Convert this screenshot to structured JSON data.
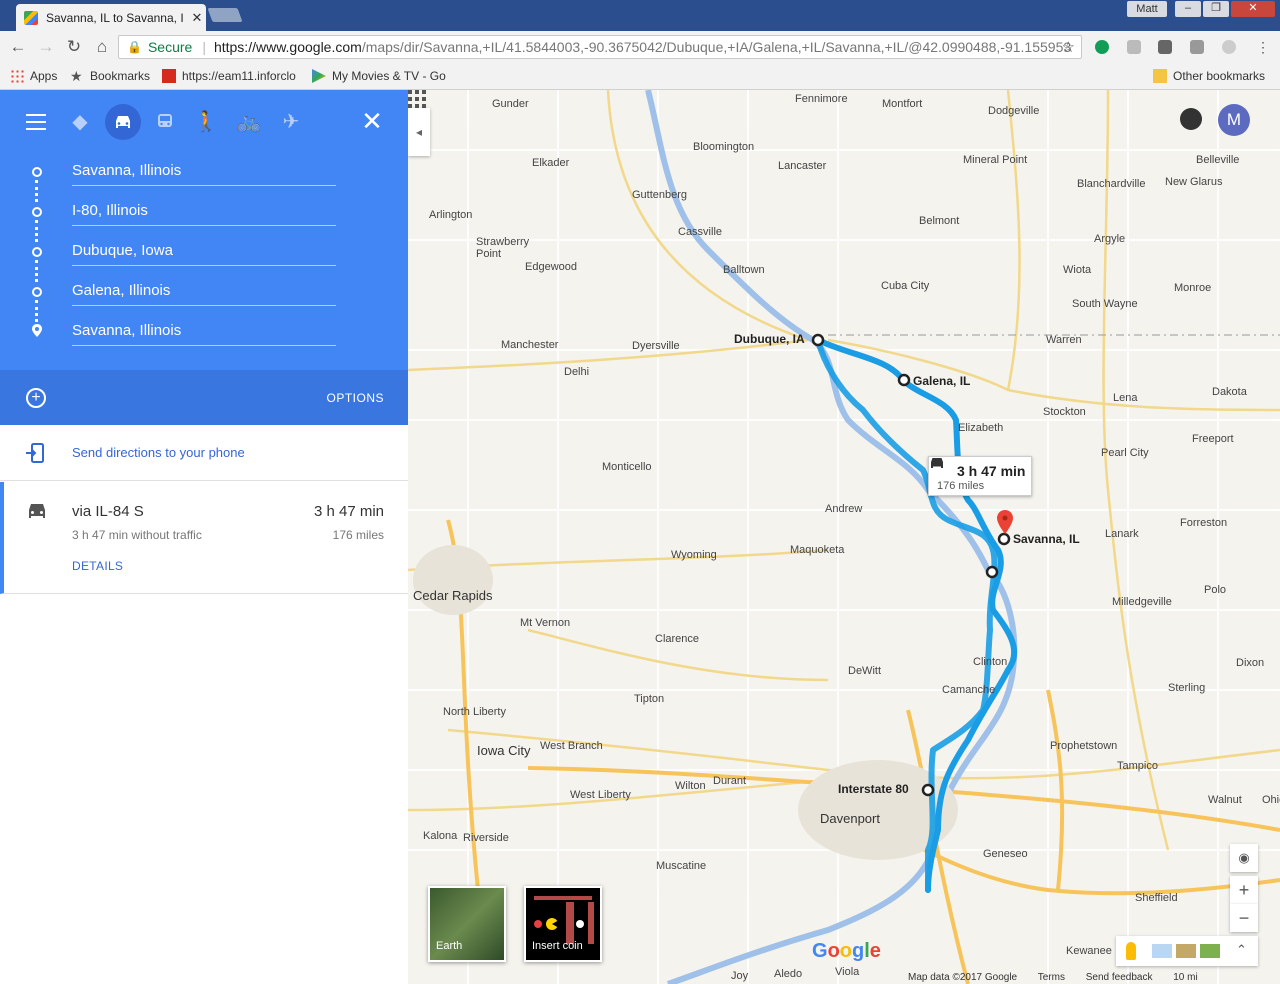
{
  "browser": {
    "tab_title": "Savanna, IL to Savanna, I",
    "user_badge": "Matt",
    "secure_label": "Secure",
    "url_host": "https://www.google.com",
    "url_rest": "/maps/dir/Savanna,+IL/41.5844003,-90.3675042/Dubuque,+IA/Galena,+IL/Savanna,+IL/@42.0990488,-91.155953",
    "bookmarks": [
      "Apps",
      "Bookmarks",
      "https://eam11.inforclo",
      "My Movies & TV - Go"
    ],
    "other_bookmarks": "Other bookmarks"
  },
  "panel": {
    "stops": [
      "Savanna, Illinois",
      "I-80, Illinois",
      "Dubuque, Iowa",
      "Galena, Illinois",
      "Savanna, Illinois"
    ],
    "options_label": "OPTIONS",
    "send_label": "Send directions to your phone",
    "route": {
      "via": "via IL-84 S",
      "time": "3 h 47 min",
      "subtitle": "3 h 47 min without traffic",
      "miles": "176 miles",
      "details": "DETAILS"
    }
  },
  "map": {
    "avatar_letter": "M",
    "infobox_time": "3 h 47 min",
    "infobox_miles": "176 miles",
    "thumb_earth": "Earth",
    "thumb_game": "Insert coin",
    "logo": "Google",
    "attribution": [
      "Map data ©2017 Google",
      "Terms",
      "Send feedback",
      "10 mi"
    ],
    "stop_labels": [
      "Dubuque, IA",
      "Galena, IL",
      "Savanna, IL",
      "Interstate 80"
    ],
    "places": [
      "Gunder",
      "Fennimore",
      "Montfort",
      "Dodgeville",
      "Elkader",
      "Bloomington",
      "Lancaster",
      "Mineral Point",
      "Belleville",
      "Guttenberg",
      "Blanchardville",
      "New Glarus",
      "Arlington",
      "Belmont",
      "Cassville",
      "Strawberry Point",
      "Argyle",
      "Edgewood",
      "Balltown",
      "Wiota",
      "Cuba City",
      "Monroe",
      "South Wayne",
      "Manchester",
      "Dyersville",
      "Warren",
      "Delhi",
      "Lena",
      "Dakota",
      "Stockton",
      "Elizabeth",
      "Freeport",
      "Pearl City",
      "Monticello",
      "Andrew",
      "Lanark",
      "Forreston",
      "Maquoketa",
      "Wyoming",
      "Cedar Rapids",
      "Mt Vernon",
      "Clarence",
      "Milledgeville",
      "Polo",
      "DeWitt",
      "Clinton",
      "Camanche",
      "Dixon",
      "Sterling",
      "Tipton",
      "North Liberty",
      "Prophetstown",
      "Iowa City",
      "West Branch",
      "Tampico",
      "Durant",
      "Wilton",
      "West Liberty",
      "Walnut",
      "Ohio",
      "Davenport",
      "Kalona",
      "Riverside",
      "Geneseo",
      "Muscatine",
      "Sheffield",
      "Kewanee",
      "Joy",
      "Aledo",
      "Viola"
    ]
  }
}
